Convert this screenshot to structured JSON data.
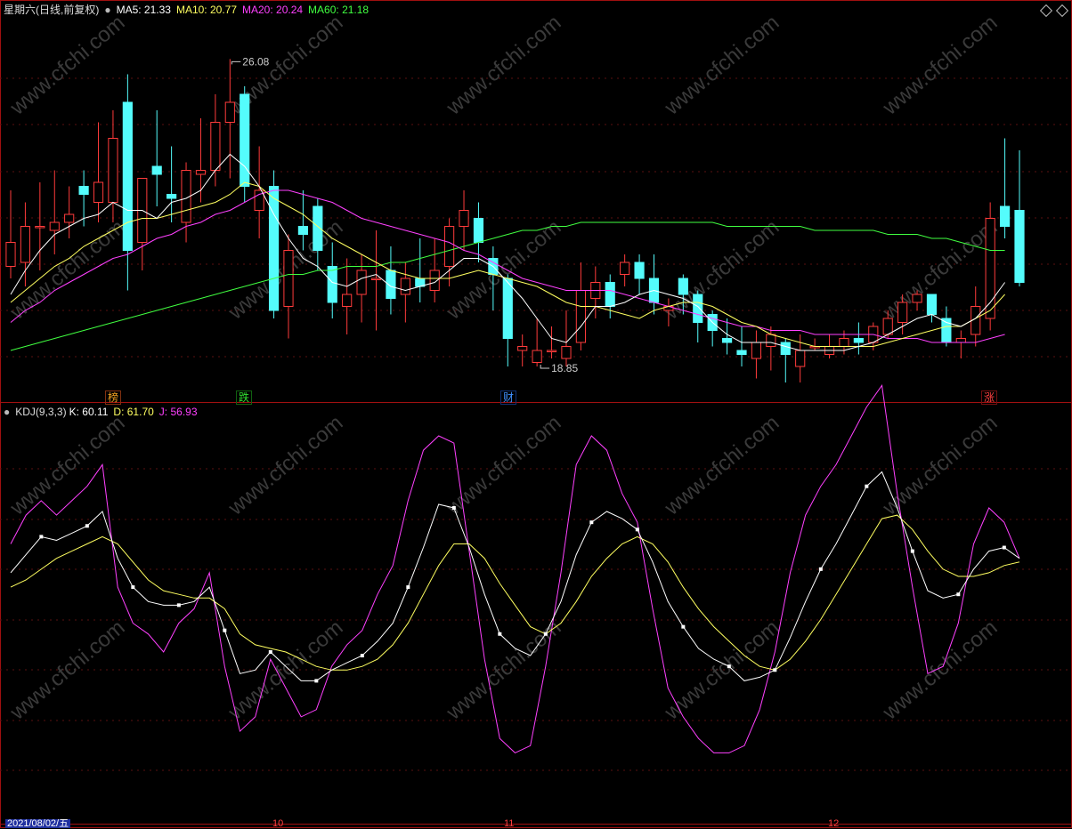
{
  "main_header": {
    "period_label": "星期六(日线,前复权)",
    "ma5": "MA5: 21.33",
    "ma10": "MA10: 20.77",
    "ma20": "MA20: 20.24",
    "ma60": "MA60: 21.18"
  },
  "kdj_header": {
    "name": "KDJ(9,3,3)",
    "k": "K: 60.11",
    "d": "D: 61.70",
    "j": "J: 56.93"
  },
  "annotations": {
    "high": "26.08",
    "low": "18.85"
  },
  "event_badges": [
    {
      "label": "榜",
      "color": "#f0a020"
    },
    {
      "label": "跌",
      "color": "#30e030"
    },
    {
      "label": "财",
      "color": "#4090ff"
    },
    {
      "label": "涨",
      "color": "#ff4040"
    }
  ],
  "axis_labels": {
    "date": "2021/08/02/五",
    "m1": "10",
    "m2": "11",
    "m3": "12"
  },
  "watermark": "www.cfchi.com",
  "colors": {
    "up": "#ff3b3b",
    "down": "#54fcfc",
    "ma5": "#ffffff",
    "ma10": "#ffff60",
    "ma20": "#ff40ff",
    "ma60": "#40ff40",
    "k": "#ffffff",
    "d": "#ffff60",
    "j": "#ff40ff"
  },
  "chart_data": [
    {
      "type": "candlestick",
      "ylim": [
        18.0,
        27.0
      ],
      "candles": [
        {
          "o": 20.9,
          "h": 22.8,
          "l": 20.6,
          "c": 21.5
        },
        {
          "o": 21.0,
          "h": 22.5,
          "l": 20.4,
          "c": 21.9
        },
        {
          "o": 21.9,
          "h": 23.0,
          "l": 20.8,
          "c": 21.9
        },
        {
          "o": 21.8,
          "h": 23.3,
          "l": 21.2,
          "c": 22.0
        },
        {
          "o": 22.0,
          "h": 22.9,
          "l": 21.6,
          "c": 22.2
        },
        {
          "o": 22.9,
          "h": 23.3,
          "l": 21.9,
          "c": 22.7
        },
        {
          "o": 22.5,
          "h": 24.5,
          "l": 22.0,
          "c": 23.0
        },
        {
          "o": 22.5,
          "h": 24.8,
          "l": 22.0,
          "c": 24.1
        },
        {
          "o": 25.0,
          "h": 25.7,
          "l": 20.3,
          "c": 21.3
        },
        {
          "o": 21.5,
          "h": 22.8,
          "l": 20.8,
          "c": 23.1
        },
        {
          "o": 23.4,
          "h": 24.8,
          "l": 22.4,
          "c": 23.2
        },
        {
          "o": 22.7,
          "h": 23.9,
          "l": 22.0,
          "c": 22.6
        },
        {
          "o": 22.0,
          "h": 23.5,
          "l": 21.5,
          "c": 23.3
        },
        {
          "o": 23.2,
          "h": 24.6,
          "l": 22.5,
          "c": 23.3
        },
        {
          "o": 23.3,
          "h": 25.2,
          "l": 22.9,
          "c": 24.5
        },
        {
          "o": 24.5,
          "h": 26.08,
          "l": 23.1,
          "c": 25.0
        },
        {
          "o": 25.2,
          "h": 25.4,
          "l": 22.5,
          "c": 22.9
        },
        {
          "o": 22.3,
          "h": 23.9,
          "l": 21.6,
          "c": 22.8
        },
        {
          "o": 22.9,
          "h": 23.3,
          "l": 19.6,
          "c": 19.8
        },
        {
          "o": 19.9,
          "h": 21.7,
          "l": 19.1,
          "c": 21.3
        },
        {
          "o": 21.9,
          "h": 22.8,
          "l": 21.3,
          "c": 21.7
        },
        {
          "o": 22.4,
          "h": 22.6,
          "l": 20.8,
          "c": 21.3
        },
        {
          "o": 20.9,
          "h": 21.5,
          "l": 19.6,
          "c": 20.0
        },
        {
          "o": 19.9,
          "h": 21.1,
          "l": 19.2,
          "c": 20.2
        },
        {
          "o": 20.2,
          "h": 21.2,
          "l": 19.5,
          "c": 20.8
        },
        {
          "o": 20.6,
          "h": 21.8,
          "l": 19.3,
          "c": 20.6
        },
        {
          "o": 20.8,
          "h": 21.4,
          "l": 19.7,
          "c": 20.1
        },
        {
          "o": 20.2,
          "h": 21.0,
          "l": 19.5,
          "c": 20.6
        },
        {
          "o": 20.6,
          "h": 21.6,
          "l": 20.0,
          "c": 20.4
        },
        {
          "o": 20.3,
          "h": 21.6,
          "l": 20.0,
          "c": 20.8
        },
        {
          "o": 20.9,
          "h": 22.1,
          "l": 20.4,
          "c": 21.9
        },
        {
          "o": 21.9,
          "h": 22.8,
          "l": 21.3,
          "c": 22.3
        },
        {
          "o": 22.1,
          "h": 22.5,
          "l": 21.0,
          "c": 21.5
        },
        {
          "o": 21.1,
          "h": 21.4,
          "l": 19.8,
          "c": 20.7
        },
        {
          "o": 20.6,
          "h": 20.7,
          "l": 18.4,
          "c": 19.1
        },
        {
          "o": 18.8,
          "h": 19.2,
          "l": 18.4,
          "c": 18.9
        },
        {
          "o": 18.5,
          "h": 19.6,
          "l": 18.4,
          "c": 18.8
        },
        {
          "o": 18.8,
          "h": 19.4,
          "l": 18.6,
          "c": 18.8
        },
        {
          "o": 18.6,
          "h": 19.8,
          "l": 18.4,
          "c": 18.9
        },
        {
          "o": 19.0,
          "h": 21.0,
          "l": 18.8,
          "c": 20.3
        },
        {
          "o": 20.1,
          "h": 20.9,
          "l": 19.6,
          "c": 20.5
        },
        {
          "o": 20.5,
          "h": 20.7,
          "l": 19.6,
          "c": 19.9
        },
        {
          "o": 20.7,
          "h": 21.2,
          "l": 20.4,
          "c": 21.0
        },
        {
          "o": 21.0,
          "h": 21.2,
          "l": 20.2,
          "c": 20.6
        },
        {
          "o": 20.6,
          "h": 21.2,
          "l": 19.7,
          "c": 20.0
        },
        {
          "o": 19.8,
          "h": 20.1,
          "l": 19.4,
          "c": 19.9
        },
        {
          "o": 20.6,
          "h": 20.7,
          "l": 19.7,
          "c": 20.2
        },
        {
          "o": 20.2,
          "h": 20.3,
          "l": 19.0,
          "c": 19.5
        },
        {
          "o": 19.7,
          "h": 19.8,
          "l": 18.9,
          "c": 19.3
        },
        {
          "o": 19.1,
          "h": 19.6,
          "l": 18.7,
          "c": 19.0
        },
        {
          "o": 18.8,
          "h": 19.4,
          "l": 18.4,
          "c": 18.7
        },
        {
          "o": 18.6,
          "h": 19.3,
          "l": 18.1,
          "c": 19.0
        },
        {
          "o": 18.9,
          "h": 19.4,
          "l": 18.3,
          "c": 19.2
        },
        {
          "o": 19.0,
          "h": 19.1,
          "l": 18.0,
          "c": 18.7
        },
        {
          "o": 18.4,
          "h": 19.2,
          "l": 18.0,
          "c": 18.8
        },
        {
          "o": 18.9,
          "h": 19.1,
          "l": 18.8,
          "c": 18.9
        },
        {
          "o": 18.7,
          "h": 19.2,
          "l": 18.6,
          "c": 18.9
        },
        {
          "o": 18.9,
          "h": 19.3,
          "l": 18.7,
          "c": 19.1
        },
        {
          "o": 19.1,
          "h": 19.5,
          "l": 18.7,
          "c": 19.0
        },
        {
          "o": 19.0,
          "h": 19.5,
          "l": 18.8,
          "c": 19.4
        },
        {
          "o": 19.2,
          "h": 19.8,
          "l": 19.1,
          "c": 19.6
        },
        {
          "o": 19.5,
          "h": 20.2,
          "l": 19.2,
          "c": 20.0
        },
        {
          "o": 20.0,
          "h": 20.3,
          "l": 19.8,
          "c": 20.2
        },
        {
          "o": 20.2,
          "h": 20.2,
          "l": 19.5,
          "c": 19.7
        },
        {
          "o": 19.6,
          "h": 19.9,
          "l": 18.9,
          "c": 19.0
        },
        {
          "o": 19.0,
          "h": 19.3,
          "l": 18.6,
          "c": 19.1
        },
        {
          "o": 19.2,
          "h": 20.4,
          "l": 18.9,
          "c": 19.9
        },
        {
          "o": 19.6,
          "h": 22.5,
          "l": 19.3,
          "c": 22.1
        },
        {
          "o": 22.4,
          "h": 24.1,
          "l": 21.6,
          "c": 21.9
        },
        {
          "o": 22.3,
          "h": 23.8,
          "l": 20.4,
          "c": 20.5
        }
      ],
      "ma5": [
        20.2,
        20.8,
        21.3,
        21.7,
        21.9,
        22.1,
        22.2,
        22.5,
        22.3,
        22.3,
        22.1,
        22.5,
        22.6,
        22.8,
        23.3,
        23.7,
        23.4,
        22.9,
        22.2,
        21.6,
        21.1,
        20.9,
        20.5,
        20.4,
        20.6,
        20.7,
        20.4,
        20.3,
        20.4,
        20.5,
        20.8,
        21.1,
        21.1,
        20.9,
        20.5,
        20.1,
        19.6,
        19.1,
        19.0,
        19.4,
        19.9,
        19.9,
        20.0,
        20.2,
        20.3,
        20.2,
        20.1,
        19.9,
        19.5,
        19.2,
        19.0,
        19.0,
        19.0,
        18.9,
        18.8,
        18.8,
        18.8,
        18.8,
        18.9,
        19.0,
        19.2,
        19.4,
        19.6,
        19.7,
        19.5,
        19.4,
        19.6,
        20.0,
        20.5
      ],
      "ma10": [
        20.0,
        20.3,
        20.6,
        20.9,
        21.1,
        21.4,
        21.6,
        21.8,
        22.0,
        22.1,
        22.1,
        22.2,
        22.3,
        22.4,
        22.5,
        22.7,
        23.0,
        22.9,
        22.6,
        22.4,
        22.2,
        21.9,
        21.6,
        21.4,
        21.2,
        21.0,
        20.8,
        20.7,
        20.6,
        20.6,
        20.6,
        20.7,
        20.8,
        20.7,
        20.6,
        20.5,
        20.4,
        20.2,
        20.0,
        19.9,
        19.9,
        19.8,
        19.7,
        19.6,
        19.8,
        19.9,
        20.0,
        20.0,
        19.9,
        19.7,
        19.5,
        19.4,
        19.2,
        19.1,
        19.0,
        18.9,
        18.9,
        18.9,
        18.9,
        18.9,
        19.0,
        19.1,
        19.2,
        19.3,
        19.4,
        19.4,
        19.6,
        19.8,
        20.2
      ],
      "ma20": [
        19.5,
        19.8,
        20.0,
        20.3,
        20.5,
        20.7,
        20.9,
        21.1,
        21.2,
        21.4,
        21.6,
        21.7,
        21.9,
        22.0,
        22.2,
        22.3,
        22.5,
        22.7,
        22.8,
        22.8,
        22.7,
        22.6,
        22.5,
        22.3,
        22.1,
        22.0,
        21.9,
        21.8,
        21.7,
        21.6,
        21.5,
        21.3,
        21.2,
        21.0,
        20.8,
        20.6,
        20.5,
        20.4,
        20.3,
        20.3,
        20.3,
        20.3,
        20.2,
        20.1,
        20.0,
        19.9,
        19.8,
        19.7,
        19.6,
        19.5,
        19.4,
        19.4,
        19.3,
        19.3,
        19.3,
        19.2,
        19.2,
        19.2,
        19.2,
        19.2,
        19.1,
        19.1,
        19.1,
        19.0,
        19.0,
        19.0,
        19.0,
        19.1,
        19.2
      ],
      "ma60": [
        18.8,
        18.9,
        19.0,
        19.1,
        19.2,
        19.3,
        19.4,
        19.5,
        19.6,
        19.7,
        19.8,
        19.9,
        20.0,
        20.1,
        20.2,
        20.3,
        20.4,
        20.5,
        20.6,
        20.7,
        20.7,
        20.8,
        20.8,
        20.9,
        20.9,
        20.9,
        21.0,
        21.0,
        21.1,
        21.2,
        21.3,
        21.4,
        21.5,
        21.6,
        21.7,
        21.8,
        21.8,
        21.9,
        21.9,
        22.0,
        22.0,
        22.0,
        22.0,
        22.0,
        22.0,
        22.0,
        22.0,
        22.0,
        22.0,
        21.9,
        21.9,
        21.9,
        21.9,
        21.9,
        21.9,
        21.8,
        21.8,
        21.8,
        21.8,
        21.8,
        21.7,
        21.7,
        21.7,
        21.6,
        21.6,
        21.5,
        21.4,
        21.3,
        21.3
      ],
      "high_index": 15,
      "low_index": 36
    },
    {
      "type": "line",
      "ylim": [
        0,
        100
      ],
      "series": [
        {
          "name": "K",
          "values": [
            62,
            67,
            72,
            71,
            73,
            75,
            79,
            66,
            58,
            54,
            53,
            53,
            54,
            58,
            46,
            34,
            35,
            40,
            36,
            32,
            32,
            35,
            37,
            39,
            43,
            48,
            58,
            69,
            81,
            80,
            69,
            56,
            45,
            41,
            39,
            45,
            54,
            67,
            76,
            79,
            77,
            74,
            65,
            54,
            47,
            41,
            38,
            36,
            32,
            33,
            35,
            44,
            54,
            63,
            70,
            78,
            86,
            90,
            80,
            68,
            57,
            55,
            56,
            63,
            68,
            69,
            66
          ]
        },
        {
          "name": "D",
          "values": [
            58,
            60,
            63,
            66,
            68,
            70,
            72,
            70,
            65,
            60,
            57,
            56,
            55,
            55,
            52,
            45,
            42,
            41,
            40,
            38,
            36,
            35,
            35,
            36,
            38,
            42,
            48,
            56,
            64,
            70,
            70,
            66,
            59,
            53,
            47,
            45,
            48,
            54,
            61,
            66,
            70,
            72,
            70,
            65,
            58,
            52,
            47,
            43,
            39,
            36,
            35,
            38,
            43,
            49,
            56,
            63,
            70,
            77,
            78,
            74,
            68,
            63,
            61,
            61,
            62,
            64,
            65
          ]
        },
        {
          "name": "J",
          "values": [
            70,
            78,
            82,
            78,
            82,
            86,
            92,
            58,
            48,
            45,
            40,
            48,
            52,
            62,
            36,
            18,
            22,
            38,
            30,
            22,
            24,
            36,
            42,
            46,
            56,
            64,
            82,
            96,
            100,
            98,
            68,
            38,
            16,
            12,
            14,
            36,
            62,
            92,
            100,
            96,
            84,
            76,
            52,
            30,
            22,
            16,
            12,
            12,
            14,
            24,
            40,
            62,
            78,
            86,
            92,
            100,
            108,
            114,
            84,
            58,
            34,
            36,
            48,
            70,
            80,
            76,
            66
          ]
        }
      ]
    }
  ]
}
